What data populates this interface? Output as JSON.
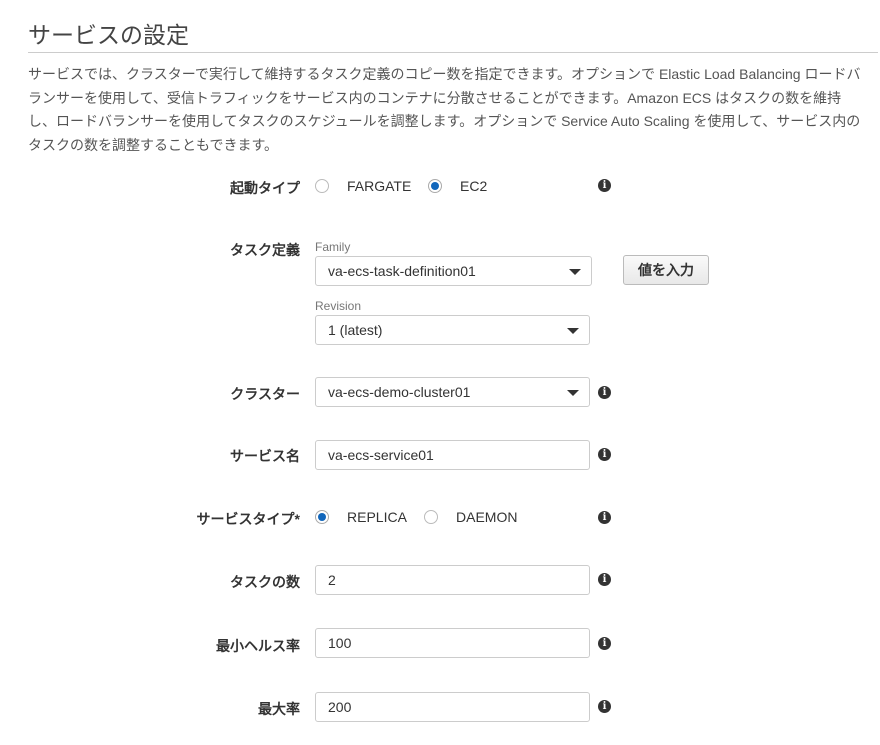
{
  "title": "サービスの設定",
  "description": "サービスでは、クラスターで実行して維持するタスク定義のコピー数を指定できます。オプションで Elastic Load Balancing ロードバランサーを使用して、受信トラフィックをサービス内のコンテナに分散させることができます。Amazon ECS はタスクの数を維持し、ロードバランサーを使用してタスクのスケジュールを調整します。オプションで Service Auto Scaling を使用して、サービス内のタスクの数を調整することもできます。",
  "launch_type": {
    "label": "起動タイプ",
    "options": [
      "FARGATE",
      "EC2"
    ],
    "selected": "EC2"
  },
  "task_definition": {
    "label": "タスク定義",
    "family_label": "Family",
    "family_value": "va-ecs-task-definition01",
    "revision_label": "Revision",
    "revision_value": "1 (latest)",
    "enter_value_button": "値を入力"
  },
  "cluster": {
    "label": "クラスター",
    "value": "va-ecs-demo-cluster01"
  },
  "service_name": {
    "label": "サービス名",
    "value": "va-ecs-service01"
  },
  "service_type": {
    "label": "サービスタイプ*",
    "options": [
      "REPLICA",
      "DAEMON"
    ],
    "selected": "REPLICA"
  },
  "task_count": {
    "label": "タスクの数",
    "value": "2"
  },
  "min_healthy": {
    "label": "最小ヘルス率",
    "value": "100"
  },
  "max_percent": {
    "label": "最大率",
    "value": "200"
  },
  "info_glyph": "i"
}
